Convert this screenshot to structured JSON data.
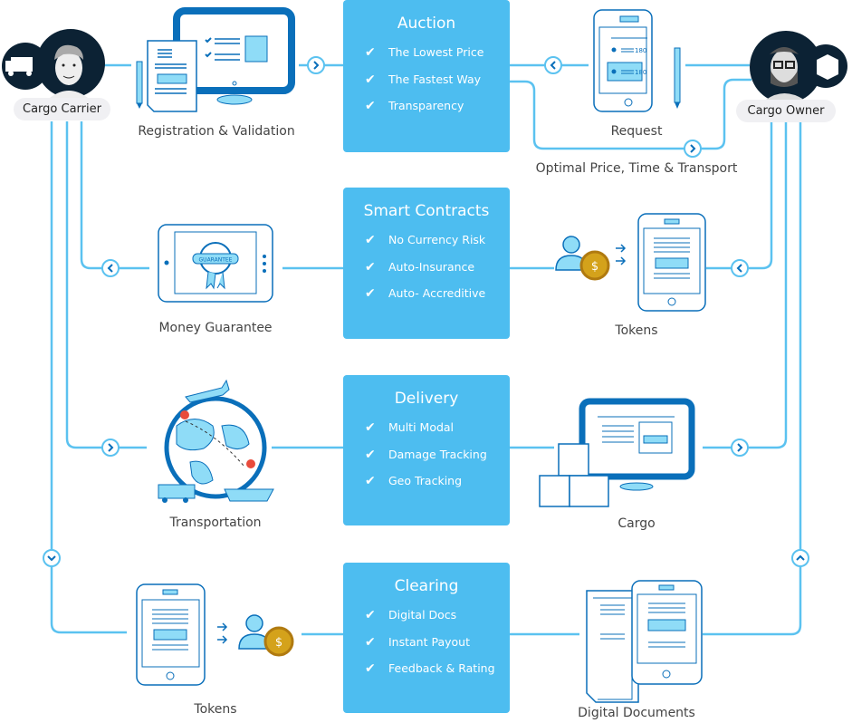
{
  "colors": {
    "box": "#4dbdf0",
    "line": "#5bc2f0",
    "icon_dark": "#0a6fba",
    "icon_fill": "#8fdcf7",
    "avatar_bg": "#0c2234"
  },
  "actors": {
    "carrier": "Cargo Carrier",
    "owner": "Cargo Owner"
  },
  "boxes": [
    {
      "title": "Auction",
      "items": [
        "The Lowest Price",
        "The Fastest Way",
        "Transparency"
      ]
    },
    {
      "title": "Smart Contracts",
      "items": [
        "No Currency Risk",
        "Auto-Insurance",
        "Auto- Accreditive"
      ]
    },
    {
      "title": "Delivery",
      "items": [
        "Multi Modal",
        "Damage Tracking",
        "Geo Tracking"
      ]
    },
    {
      "title": "Clearing",
      "items": [
        "Digital Docs",
        "Instant Payout",
        "Feedback & Rating"
      ]
    }
  ],
  "labels": {
    "registration": "Registration & Validation",
    "request": "Request",
    "optimal": "Optimal Price, Time & Transport",
    "money_guarantee": "Money Guarantee",
    "tokens_right": "Tokens",
    "transportation": "Transportation",
    "cargo": "Cargo",
    "tokens_left": "Tokens",
    "digital_documents": "Digital Documents"
  },
  "icon_text": {
    "guarantee": "GUARANTEE",
    "request_value_1": "180",
    "request_value_2": "180",
    "coin": "$"
  }
}
